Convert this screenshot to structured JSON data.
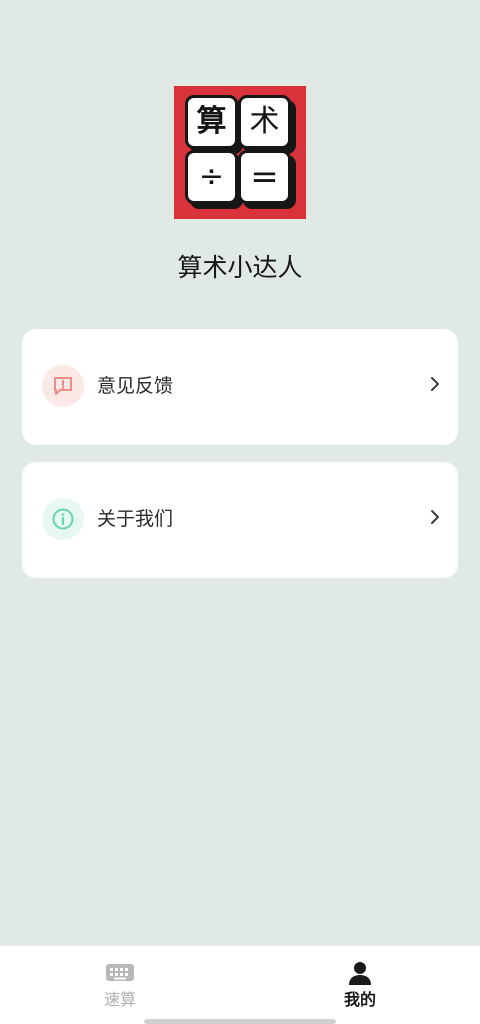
{
  "logo": {
    "tiles": [
      "算",
      "术",
      "÷",
      "="
    ],
    "background_color": "#d8333a"
  },
  "app": {
    "name": "算术小达人"
  },
  "menu": [
    {
      "label": "意见反馈",
      "icon": "feedback-icon",
      "icon_color": "#ee8a86"
    },
    {
      "label": "关于我们",
      "icon": "info-icon",
      "icon_color": "#62d3b4"
    }
  ],
  "tabbar": {
    "items": [
      {
        "label": "速算",
        "icon": "keyboard-icon",
        "active": false
      },
      {
        "label": "我的",
        "icon": "user-icon",
        "active": true
      }
    ]
  }
}
